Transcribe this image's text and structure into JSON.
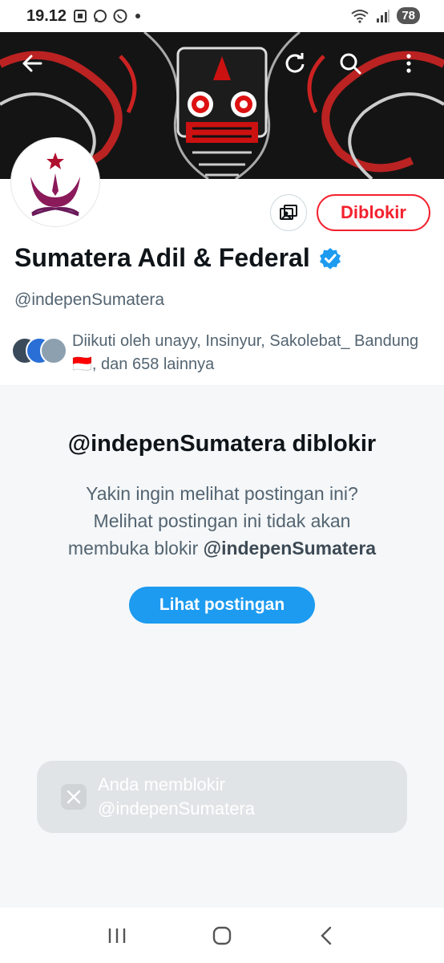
{
  "status_bar": {
    "time": "19.12",
    "battery": "78",
    "icons_left": [
      "screenshot-icon",
      "message-icon",
      "whatsapp-icon",
      "dot-icon"
    ],
    "icons_right": [
      "wifi-icon",
      "signal-icon",
      "battery-icon"
    ]
  },
  "header": {
    "back_icon": "arrow-left-icon",
    "refresh_icon": "refresh-icon",
    "search_icon": "search-icon",
    "more_icon": "more-vertical-icon"
  },
  "profile": {
    "display_name": "Sumatera Adil & Federal",
    "verified_icon": "verified-badge-icon",
    "handle": "@indepenSumatera",
    "blocked_label": "Diblokir",
    "followed_by_text": "Diikuti oleh unayy, Insinyur, Sakolebat_ Bandung🇮🇩, dan 658 lainnya"
  },
  "blocked_panel": {
    "title": "@indepenSumatera diblokir",
    "message_line1": "Yakin ingin melihat postingan ini?",
    "message_line2": "Melihat postingan ini tidak akan",
    "message_line3_prefix": "membuka blokir ",
    "message_handle": "@indepenSumatera",
    "view_posts_label": "Lihat postingan"
  },
  "toast": {
    "line1": "Anda memblokir",
    "line2": "@indepenSumatera",
    "icon": "x-logo-icon"
  },
  "nav_bar": {
    "items": [
      "recent-apps-icon",
      "home-icon",
      "back-icon"
    ]
  },
  "colors": {
    "accent_blue": "#1d9bf0",
    "blocked_red": "#f4212e",
    "muted_text": "#536471",
    "verified_blue": "#1d9bf0"
  }
}
